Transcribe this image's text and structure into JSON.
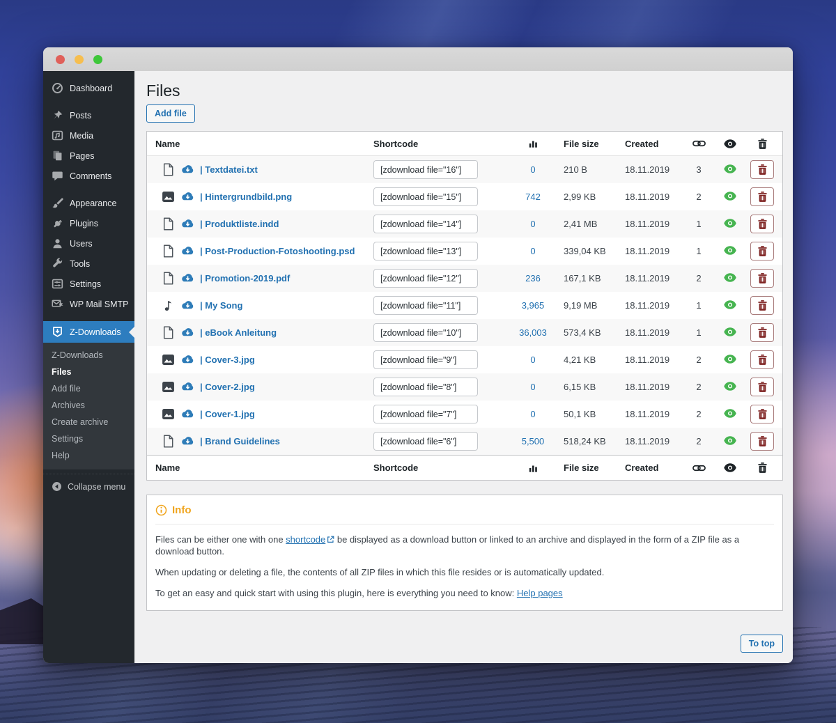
{
  "window": {
    "traffic_lights": [
      "close",
      "minimize",
      "zoom"
    ]
  },
  "sidebar": {
    "items": [
      {
        "label": "Dashboard",
        "icon": "dashboard-icon"
      },
      {
        "label": "Posts",
        "icon": "pushpin-icon",
        "gap_before": true
      },
      {
        "label": "Media",
        "icon": "media-icon"
      },
      {
        "label": "Pages",
        "icon": "pages-icon"
      },
      {
        "label": "Comments",
        "icon": "comments-icon"
      },
      {
        "label": "Appearance",
        "icon": "brush-icon",
        "gap_before": true
      },
      {
        "label": "Plugins",
        "icon": "plugin-icon"
      },
      {
        "label": "Users",
        "icon": "users-icon"
      },
      {
        "label": "Tools",
        "icon": "wrench-icon"
      },
      {
        "label": "Settings",
        "icon": "settings-icon"
      },
      {
        "label": "WP Mail SMTP",
        "icon": "mail-icon"
      },
      {
        "label": "Z-Downloads",
        "icon": "download-icon",
        "active": true,
        "gap_before": true
      }
    ],
    "submenu": [
      {
        "label": "Z-Downloads"
      },
      {
        "label": "Files",
        "current": true
      },
      {
        "label": "Add file"
      },
      {
        "label": "Archives"
      },
      {
        "label": "Create archive"
      },
      {
        "label": "Settings"
      },
      {
        "label": "Help"
      }
    ],
    "collapse_label": "Collapse menu",
    "collapse_icon": "collapse-arrow-icon"
  },
  "page": {
    "title": "Files",
    "add_file_button": "Add file",
    "to_top_button": "To top"
  },
  "table": {
    "headers": {
      "name": "Name",
      "shortcode": "Shortcode",
      "file_size": "File size",
      "created": "Created"
    },
    "header_icons": {
      "downloads": "bar-chart-icon",
      "links": "link-icon",
      "visibility": "eye-icon",
      "delete": "trash-icon"
    },
    "type_icons": {
      "file": "file-icon",
      "image": "image-icon",
      "audio": "audio-note-icon"
    },
    "row_download_icon": "cloud-download-icon",
    "row_eye_icon": "eye-icon",
    "row_delete_icon": "trash-icon",
    "rows": [
      {
        "type": "file",
        "name": "| Textdatei.txt",
        "shortcode": "[zdownload file=\"16\"]",
        "downloads": "0",
        "file_size": "210 B",
        "created": "18.11.2019",
        "links": "3"
      },
      {
        "type": "image",
        "name": "| Hintergrundbild.png",
        "shortcode": "[zdownload file=\"15\"]",
        "downloads": "742",
        "file_size": "2,99 KB",
        "created": "18.11.2019",
        "links": "2"
      },
      {
        "type": "file",
        "name": "| Produktliste.indd",
        "shortcode": "[zdownload file=\"14\"]",
        "downloads": "0",
        "file_size": "2,41 MB",
        "created": "18.11.2019",
        "links": "1"
      },
      {
        "type": "file",
        "name": "| Post-Production-Fotoshooting.psd",
        "shortcode": "[zdownload file=\"13\"]",
        "downloads": "0",
        "file_size": "339,04 KB",
        "created": "18.11.2019",
        "links": "1"
      },
      {
        "type": "file",
        "name": "| Promotion-2019.pdf",
        "shortcode": "[zdownload file=\"12\"]",
        "downloads": "236",
        "file_size": "167,1 KB",
        "created": "18.11.2019",
        "links": "2"
      },
      {
        "type": "audio",
        "name": "| My Song",
        "shortcode": "[zdownload file=\"11\"]",
        "downloads": "3,965",
        "file_size": "9,19 MB",
        "created": "18.11.2019",
        "links": "1"
      },
      {
        "type": "file",
        "name": "| eBook Anleitung",
        "shortcode": "[zdownload file=\"10\"]",
        "downloads": "36,003",
        "file_size": "573,4 KB",
        "created": "18.11.2019",
        "links": "1"
      },
      {
        "type": "image",
        "name": "| Cover-3.jpg",
        "shortcode": "[zdownload file=\"9\"]",
        "downloads": "0",
        "file_size": "4,21 KB",
        "created": "18.11.2019",
        "links": "2"
      },
      {
        "type": "image",
        "name": "| Cover-2.jpg",
        "shortcode": "[zdownload file=\"8\"]",
        "downloads": "0",
        "file_size": "6,15 KB",
        "created": "18.11.2019",
        "links": "2"
      },
      {
        "type": "image",
        "name": "| Cover-1.jpg",
        "shortcode": "[zdownload file=\"7\"]",
        "downloads": "0",
        "file_size": "50,1 KB",
        "created": "18.11.2019",
        "links": "2"
      },
      {
        "type": "file",
        "name": "| Brand Guidelines",
        "shortcode": "[zdownload file=\"6\"]",
        "downloads": "5,500",
        "file_size": "518,24 KB",
        "created": "18.11.2019",
        "links": "2"
      }
    ]
  },
  "info": {
    "icon": "info-circle-icon",
    "title": "Info",
    "p1_pre": "Files can be either one with one ",
    "p1_link": "shortcode",
    "p1_link_icon": "external-link-icon",
    "p1_post": " be displayed as a download button or linked to an archive and displayed in the form of a ZIP file as a download button.",
    "p2": "When updating or deleting a file, the contents of all ZIP files in which this file resides or is automatically updated.",
    "p3_pre": "To get an easy and quick start with using this plugin, here is everything you need to know: ",
    "p3_link": "Help pages"
  },
  "colors": {
    "accent_blue": "#2271b1",
    "active_menu_blue": "#2d7dbf",
    "eye_green": "#46b450",
    "delete_red": "#7f2423",
    "info_orange": "#f0a51e"
  }
}
